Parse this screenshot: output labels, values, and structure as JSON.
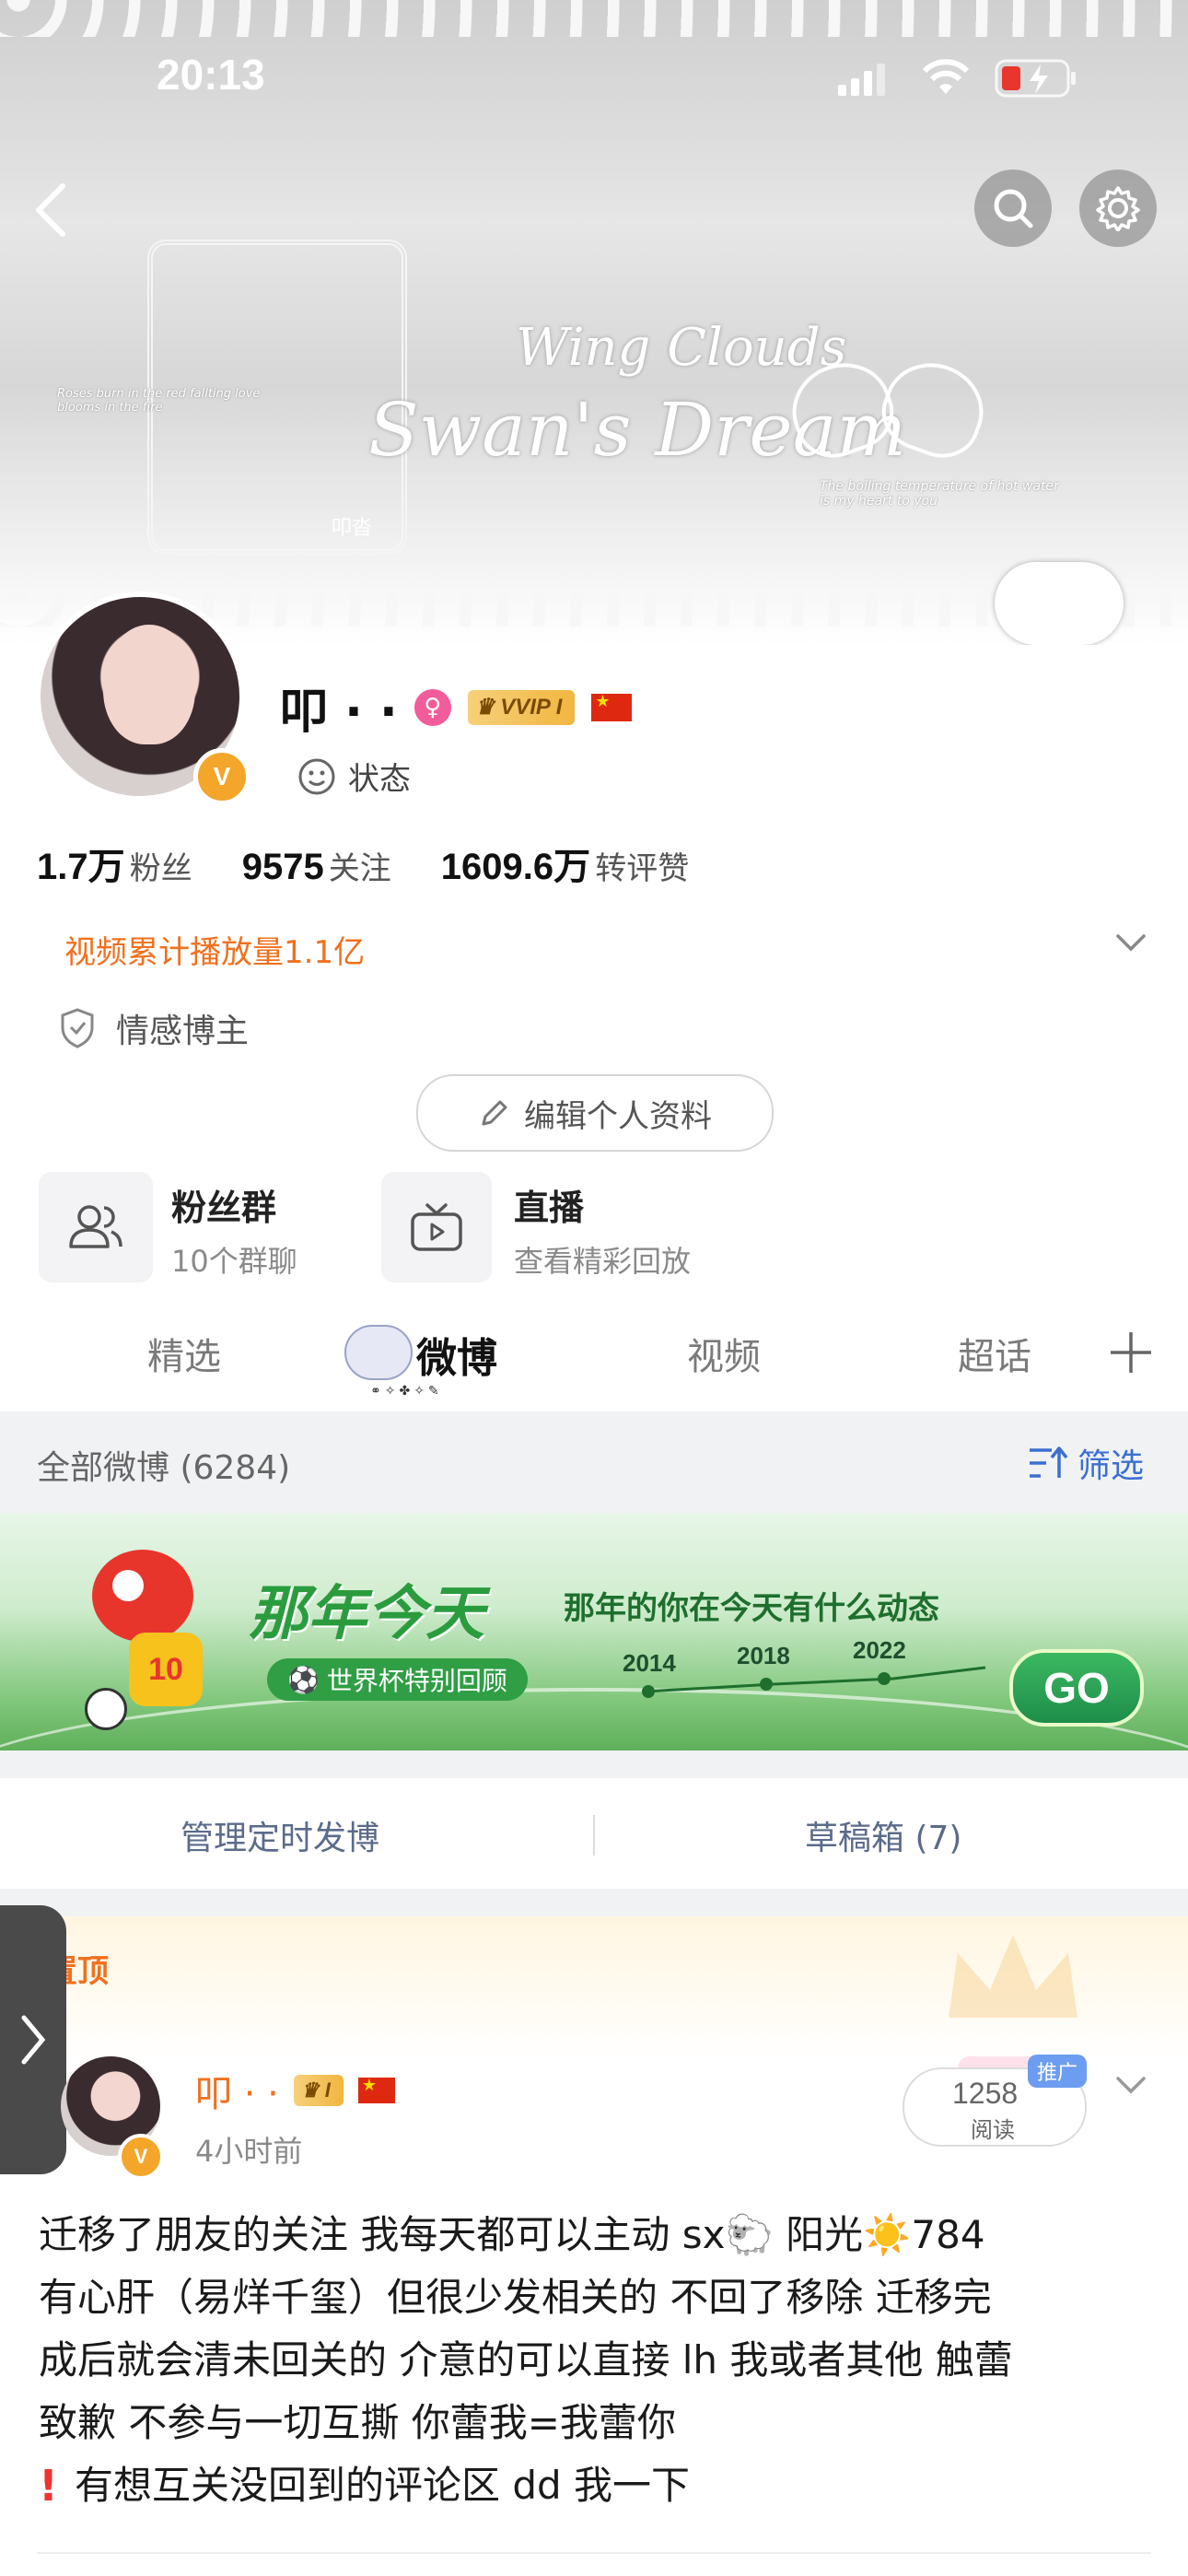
{
  "status_bar": {
    "time": "20:13"
  },
  "banner": {
    "title_line1": "Wing Clouds",
    "title_line2": "Swan's Dream",
    "left_tag": "Roses burn in the red fallting love blooms in the fire",
    "right_tag": "The boiling temperature of hot water is my heart to you",
    "name_tag": "叩沓"
  },
  "profile": {
    "name": "叩 · ·",
    "vip": "VVIP I",
    "status_label": "状态",
    "stats": [
      {
        "value": "1.7万",
        "label": "粉丝"
      },
      {
        "value": "9575",
        "label": "关注"
      },
      {
        "value": "1609.6万",
        "label": "转评赞"
      }
    ],
    "video_plays": "视频累计播放量1.1亿",
    "tag": "情感博主",
    "edit_button": "编辑个人资料"
  },
  "quick_cards": [
    {
      "title": "粉丝群",
      "subtitle": "10个群聊"
    },
    {
      "title": "直播",
      "subtitle": "查看精彩回放"
    }
  ],
  "tabs": [
    {
      "label": "精选"
    },
    {
      "label": "微博"
    },
    {
      "label": "视频"
    },
    {
      "label": "超话"
    }
  ],
  "feed": {
    "all_label": "全部微博 (6284)",
    "filter_label": "筛选"
  },
  "promo": {
    "title": "那年今天",
    "subtitle": "那年的你在今天有什么动态",
    "badge": "世界杯特别回顾",
    "years": [
      "2014",
      "2018",
      "2022"
    ],
    "go": "GO"
  },
  "actions": {
    "scheduled": "管理定时发博",
    "drafts": "草稿箱 (7)"
  },
  "post": {
    "pinned": "置顶",
    "author": "叩 · ·",
    "time": "4小时前",
    "promote": "推广",
    "reads": "1258",
    "reads_label": "阅读",
    "line1": "迁移了朋友的关注  我每天都可以主动 sx🐑  阳光☀️784",
    "line2": "有心肝（易烊千玺）但很少发相关的  不回了移除  迁移完",
    "line3": "成后就会清未回关的  介意的可以直接 lh 我或者其他  触蕾",
    "line4": "致歉   不参与一切互撕  你蕾我=我蕾你",
    "line5": "有想互关没回到的评论区 dd 我一下"
  },
  "colors": {
    "orange": "#f0701e",
    "blue": "#3b6fd1",
    "green_go": "#1e8e4a"
  }
}
